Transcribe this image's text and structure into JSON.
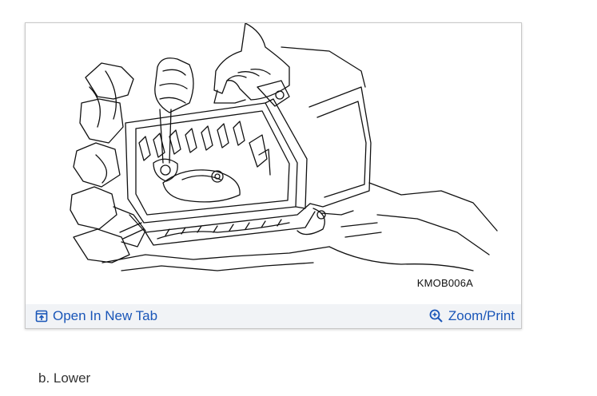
{
  "figure": {
    "code": "KMOB006A",
    "open_tab_label": "Open In New Tab",
    "zoom_label": "Zoom/Print",
    "open_tab_icon": "open-in-new-tab-icon",
    "zoom_icon": "zoom-in-icon",
    "link_color": "#1a56b8"
  },
  "caption": "b. Lower"
}
